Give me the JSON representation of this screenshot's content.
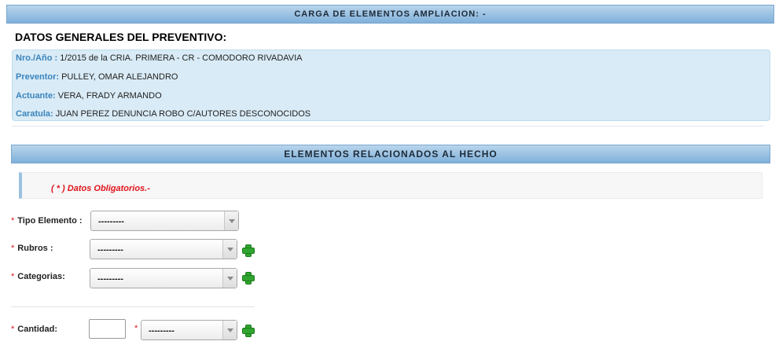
{
  "header": {
    "title": "CARGA DE ELEMENTOS AMPLIACION: -"
  },
  "general": {
    "title": "DATOS GENERALES DEL PREVENTIVO:",
    "rows": [
      {
        "label": "Nro./Año :",
        "value": "1/2015 de la CRIA. PRIMERA - CR - COMODORO RIVADAVIA"
      },
      {
        "label": "Preventor:",
        "value": "PULLEY, OMAR ALEJANDRO"
      },
      {
        "label": "Actuante:",
        "value": "VERA, FRADY ARMANDO"
      },
      {
        "label": "Caratula:",
        "value": "JUAN PEREZ DENUNCIA ROBO C/AUTORES DESCONOCIDOS"
      }
    ]
  },
  "section": {
    "title": "ELEMENTOS RELACIONADOS AL HECHO"
  },
  "alert": {
    "text": "( * ) Datos Obligatorios.-"
  },
  "form": {
    "required_mark": "*",
    "tipo": {
      "label": "Tipo Elemento :",
      "value": "---------"
    },
    "rubros": {
      "label": "Rubros :",
      "value": "---------"
    },
    "categorias": {
      "label": "Categorias:",
      "value": "---------"
    },
    "cantidad": {
      "label": "Cantidad:",
      "value": "",
      "unit_value": "---------"
    }
  },
  "icons": {
    "add": "plus-icon",
    "dropdown": "chevron-down-icon"
  },
  "colors": {
    "header_bar": "#7fb0da",
    "info_bg": "#d9ebf6",
    "label_blue": "#3a84bd",
    "required_red": "#e0141c",
    "add_green": "#2fa52f"
  }
}
